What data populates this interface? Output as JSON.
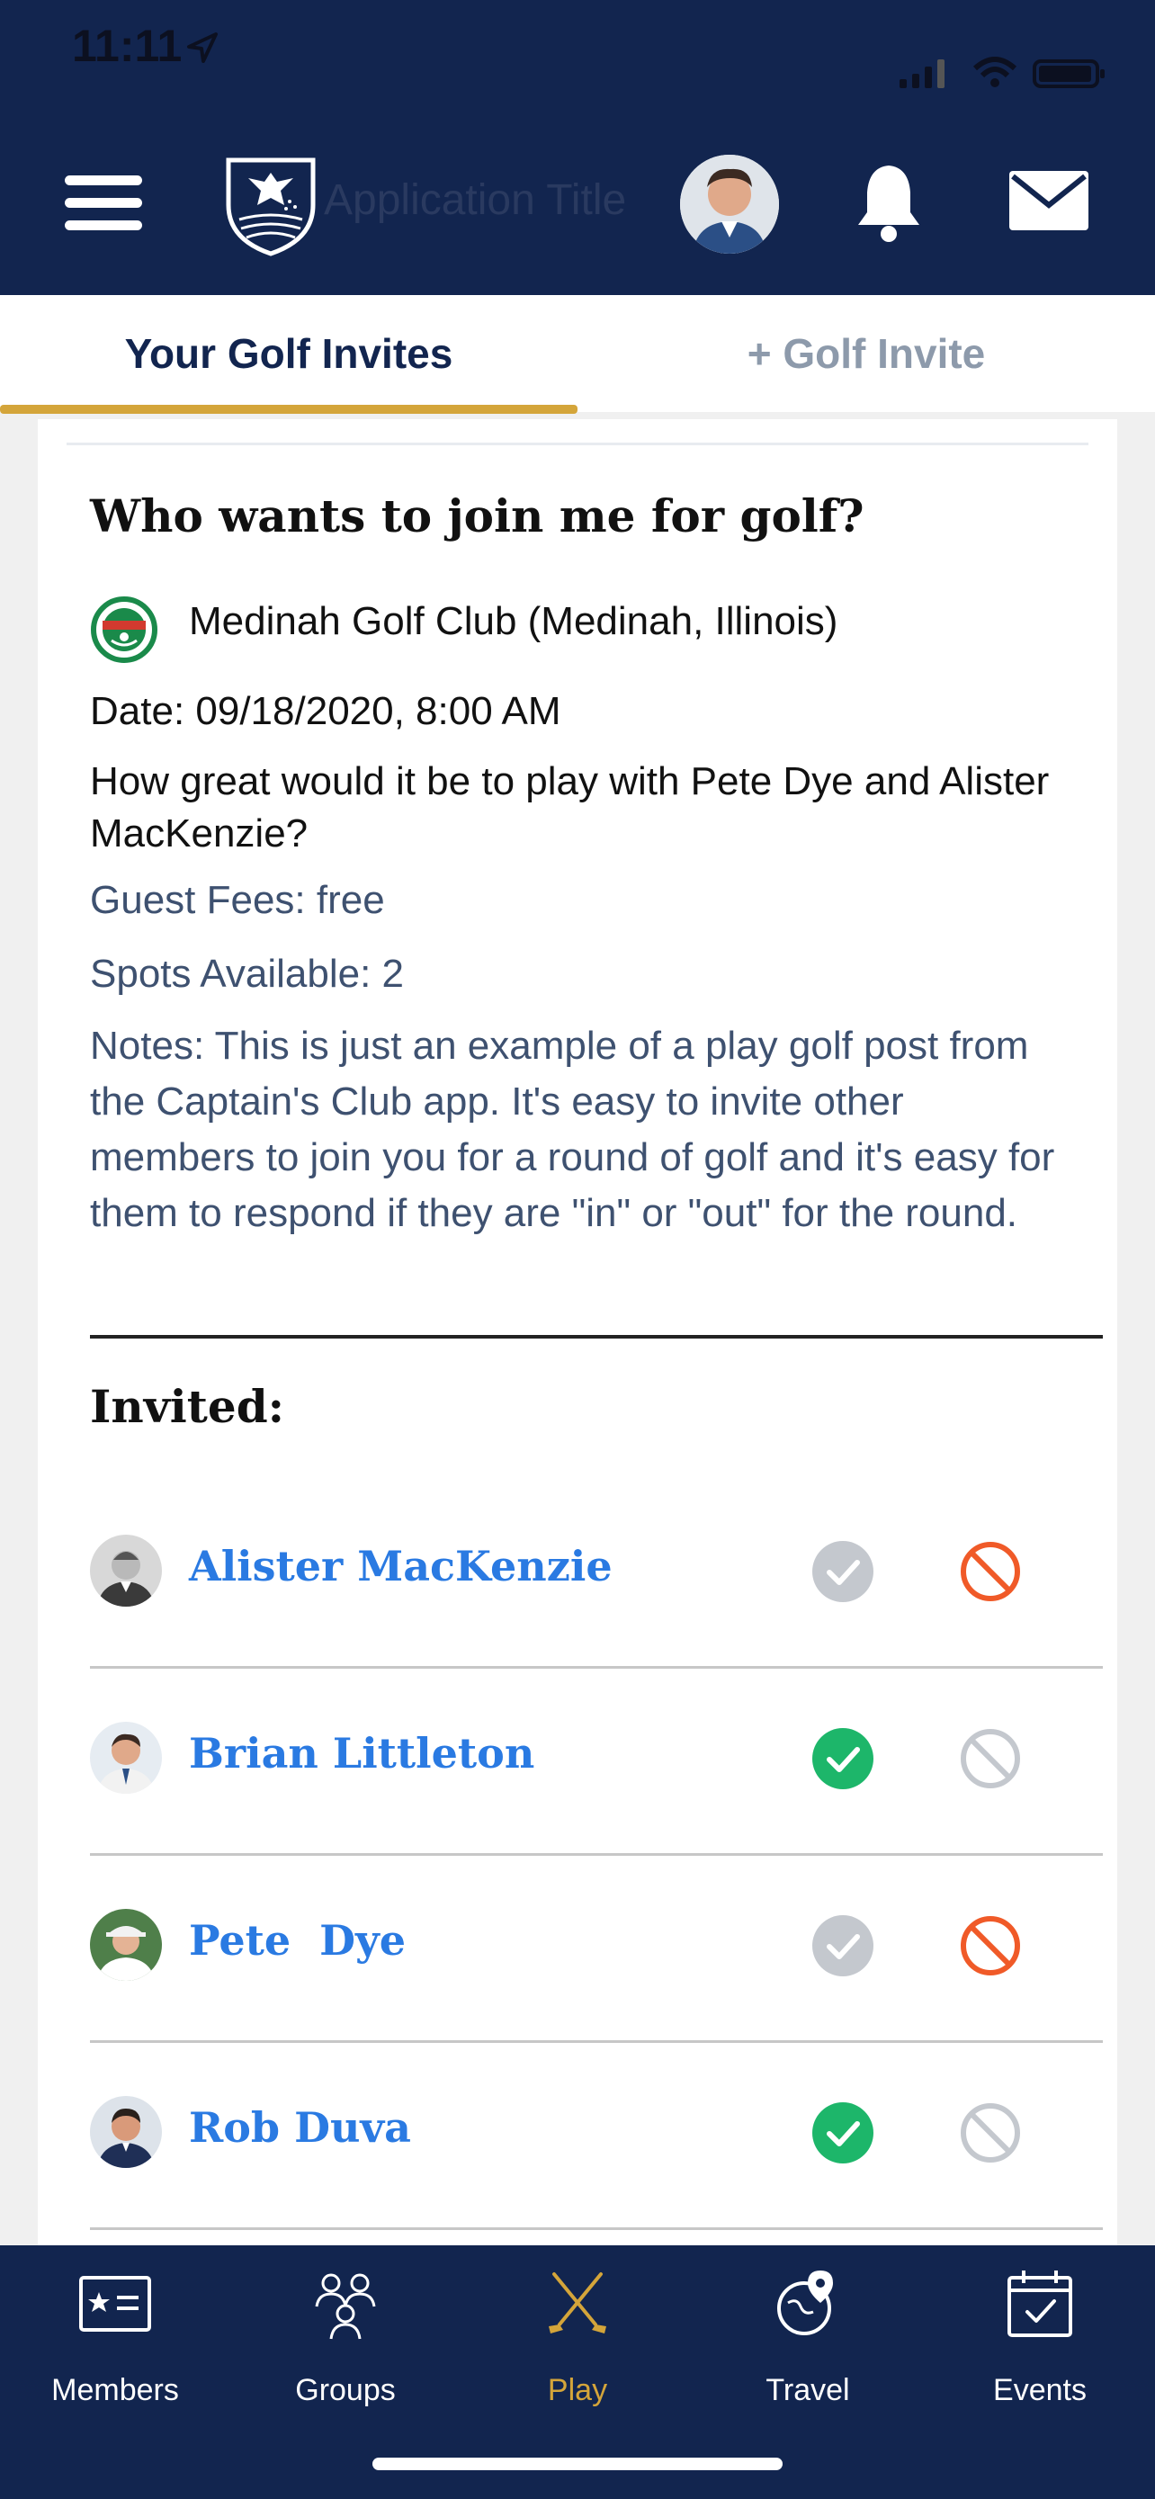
{
  "status": {
    "time": "11:11"
  },
  "header": {
    "app_title": "Application Title"
  },
  "tabs": {
    "your_invites": "Your Golf Invites",
    "new_invite": "+ Golf Invite"
  },
  "post": {
    "title": "Who wants to join me for golf?",
    "club": "Medinah Golf Club (Medinah, Illinois)",
    "date": "Date: 09/18/2020, 8:00 AM",
    "description": "How great would it be to play with Pete Dye and Alister MacKenzie?",
    "guest_fees": "Guest Fees: free",
    "spots": "Spots Available: 2",
    "notes": "Notes: This is just an example of a play golf post from the Captain's Club app.  It's easy to invite other members to join you for a round of golf and it's easy for them to respond if they are \"in\" or \"out\" for the round."
  },
  "invited": {
    "heading": "Invited:",
    "members": [
      {
        "name": "Alister MacKenzie",
        "status": "out"
      },
      {
        "name": "Brian Littleton",
        "status": "in"
      },
      {
        "name": "Pete  Dye",
        "status": "out"
      },
      {
        "name": "Rob Duva",
        "status": "in"
      }
    ]
  },
  "bottom_nav": {
    "items": [
      {
        "label": "Members",
        "icon": "members-card-icon"
      },
      {
        "label": "Groups",
        "icon": "groups-icon"
      },
      {
        "label": "Play",
        "icon": "golf-clubs-icon",
        "active": true
      },
      {
        "label": "Travel",
        "icon": "travel-globe-icon"
      },
      {
        "label": "Events",
        "icon": "calendar-icon"
      }
    ]
  },
  "colors": {
    "header_bg": "#12254f",
    "tab_accent": "#d4a53a",
    "name_link": "#2a7ae2",
    "in_green": "#1db66a",
    "out_red": "#f05a28",
    "inactive_gray": "#c4c8ce",
    "nav_active": "#d4a53a"
  }
}
